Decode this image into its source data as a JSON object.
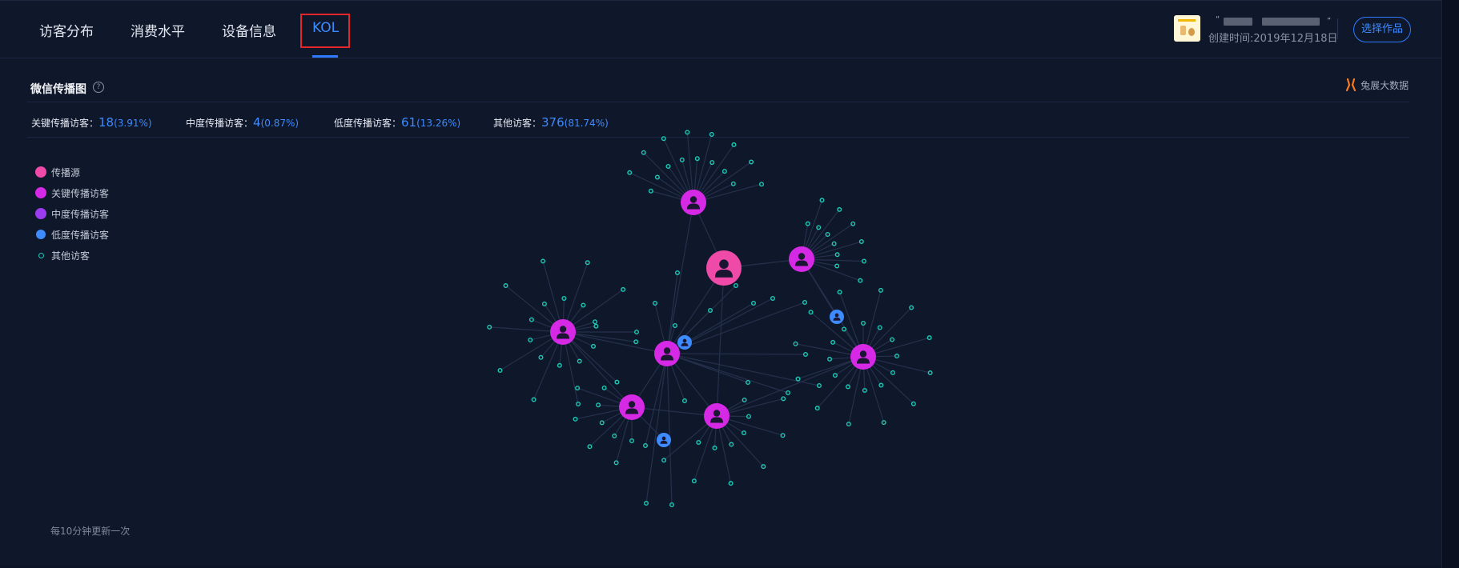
{
  "tabs": [
    {
      "label": "访客分布",
      "active": false
    },
    {
      "label": "消费水平",
      "active": false
    },
    {
      "label": "设备信息",
      "active": false
    },
    {
      "label": "KOL",
      "active": true
    }
  ],
  "work": {
    "name_open": "“",
    "name_close": "”",
    "created": "创建时间:2019年12月18日",
    "select_button": "选择作品"
  },
  "section": {
    "title": "微信传播图",
    "help_icon": "question-circle-icon",
    "brand": "兔展大数据"
  },
  "stats": [
    {
      "label": "关键传播访客：",
      "count": "18",
      "percent": "(3.91%)"
    },
    {
      "label": "中度传播访客：",
      "count": "4",
      "percent": "(0.87%)"
    },
    {
      "label": "低度传播访客：",
      "count": "61",
      "percent": "(13.26%)"
    },
    {
      "label": "其他访客：",
      "count": "376",
      "percent": "(81.74%)"
    }
  ],
  "legend": [
    {
      "label": "传播源",
      "color": "#ef4aa8",
      "icon": "user-icon"
    },
    {
      "label": "关键传播访客",
      "color": "#d629e6",
      "icon": "user-icon"
    },
    {
      "label": "中度传播访客",
      "color": "#9b3cf0",
      "icon": "user-icon"
    },
    {
      "label": "低度传播访客",
      "color": "#3d8bff",
      "icon": "user-icon"
    },
    {
      "label": "其他访客",
      "color": "#1ec9b4",
      "icon": "ring-icon"
    }
  ],
  "footer": "每10分钟更新一次",
  "colors": {
    "accent": "#3d8bff",
    "source": "#ef4aa8",
    "key": "#d629e6",
    "low": "#3d8bff",
    "other": "#1ec9b4",
    "edge": "#25304b"
  }
}
